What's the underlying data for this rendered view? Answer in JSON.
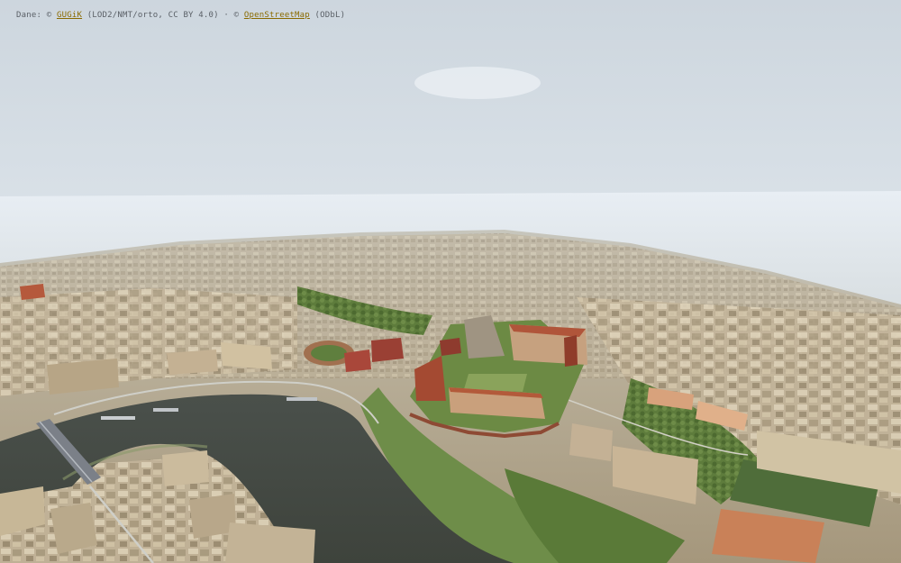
{
  "attribution": {
    "prefix": "Dane: ©",
    "gugik_link": "GUGiK",
    "gugik_note": "(LOD2/NMT/orto, CC BY 4.0) · ©",
    "osm_link": "OpenStreetMap",
    "osm_note": "(ODbL)"
  },
  "map": {
    "view": "3d-aerial",
    "colors": {
      "sky_top": "#c9d3dc",
      "sky_horizon": "#e9eef3",
      "river": "#454a43",
      "park": "#5f7f3e",
      "buildings": "#b9a98d",
      "roofs_red": "#b0553a",
      "tennis_court": "#c98158"
    }
  }
}
